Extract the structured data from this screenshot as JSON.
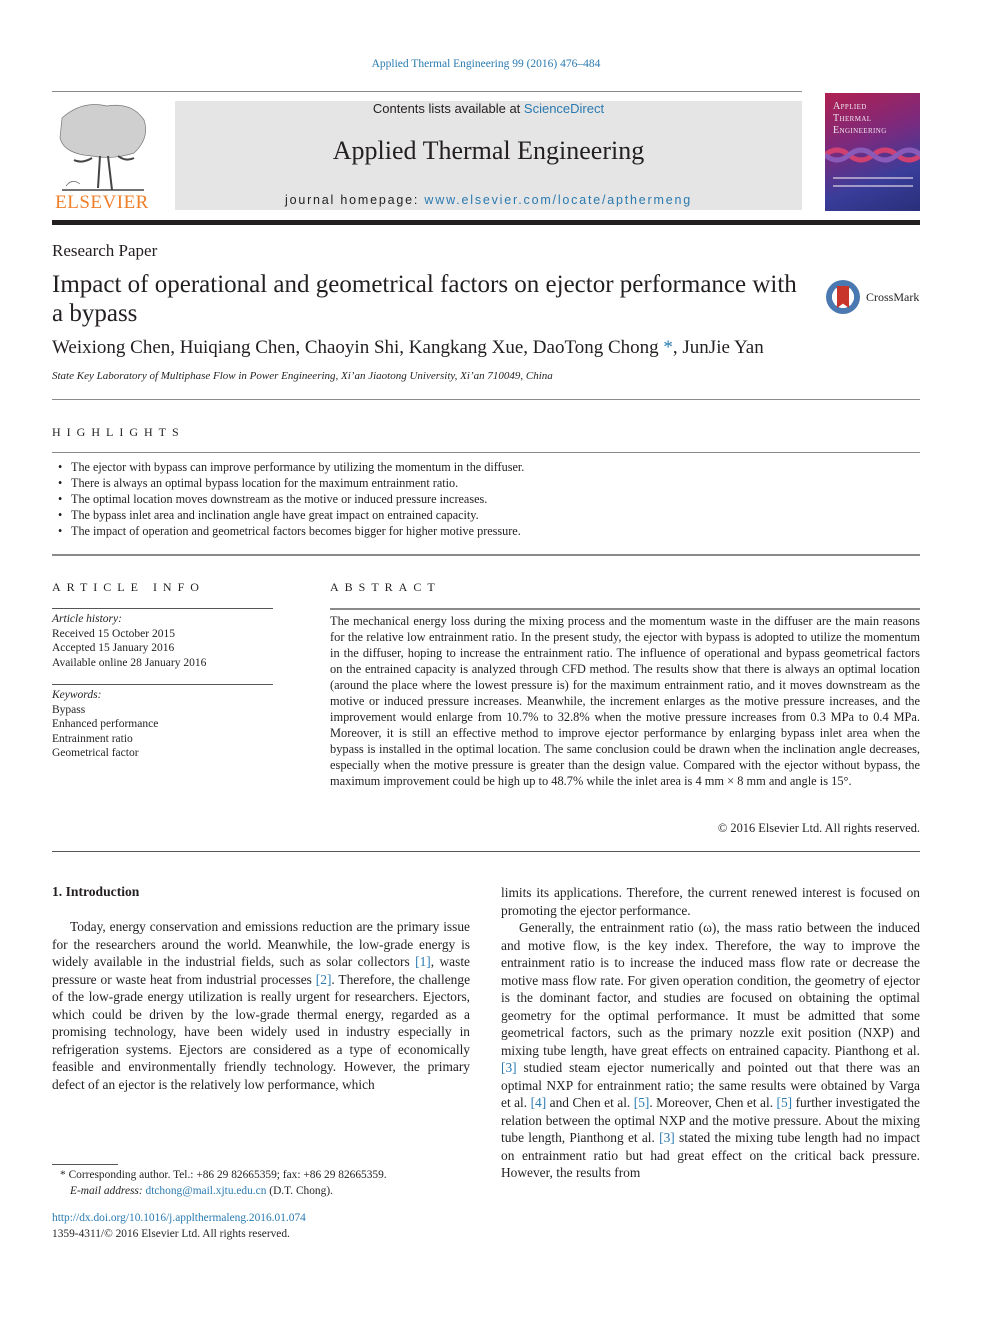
{
  "header": {
    "journal_ref": "Applied Thermal Engineering 99 (2016) 476–484",
    "contents_prefix": "Contents lists available at ",
    "contents_link": "ScienceDirect",
    "journal_title": "Applied Thermal Engineering",
    "homepage_prefix": "journal homepage: ",
    "homepage_link": "www.elsevier.com/locate/apthermeng",
    "publisher_logo_text": "ELSEVIER",
    "cover_title_lines": [
      "Applied",
      "Thermal",
      "Engineering"
    ],
    "publisher_color": "#f07f2a",
    "link_color": "#2a7ab0"
  },
  "article": {
    "type": "Research Paper",
    "title": "Impact of operational and geometrical factors on ejector performance with a bypass",
    "crossmark_label": "CrossMark",
    "authors_before_star": "Weixiong Chen, Huiqiang Chen, Chaoyin Shi, Kangkang Xue, DaoTong Chong ",
    "author_star": "*",
    "authors_after_star": ", JunJie Yan",
    "affiliation": "State Key Laboratory of Multiphase Flow in Power Engineering, Xi’an Jiaotong University, Xi’an 710049, China"
  },
  "highlights": {
    "label": "HIGHLIGHTS",
    "bullet": "•",
    "items": [
      "The ejector with bypass can improve performance by utilizing the momentum in the diffuser.",
      "There is always an optimal bypass location for the maximum entrainment ratio.",
      "The optimal location moves downstream as the motive or induced pressure increases.",
      "The bypass inlet area and inclination angle have great impact on entrained capacity.",
      "The impact of operation and geometrical factors becomes bigger for higher motive pressure."
    ]
  },
  "article_info": {
    "label": "ARTICLE INFO",
    "history_heading": "Article history:",
    "history": [
      "Received 15 October 2015",
      "Accepted 15 January 2016",
      "Available online 28 January 2016"
    ],
    "keywords_heading": "Keywords:",
    "keywords": [
      "Bypass",
      "Enhanced performance",
      "Entrainment ratio",
      "Geometrical factor"
    ]
  },
  "abstract": {
    "label": "ABSTRACT",
    "text": "The mechanical energy loss during the mixing process and the momentum waste in the diffuser are the main reasons for the relative low entrainment ratio. In the present study, the ejector with bypass is adopted to utilize the momentum in the diffuser, hoping to increase the entrainment ratio. The influence of operational and bypass geometrical factors on the entrained capacity is analyzed through CFD method. The results show that there is always an optimal location (around the place where the lowest pressure is) for the maximum entrainment ratio, and it moves downstream as the motive or induced pressure increases. Meanwhile, the increment enlarges as the motive pressure increases, and the improvement would enlarge from 10.7% to 32.8% when the motive pressure increases from 0.3 MPa to 0.4 MPa. Moreover, it is still an effective method to improve ejector performance by enlarging bypass inlet area when the bypass is installed in the optimal location. The same conclusion could be drawn when the inclination angle decreases, especially when the motive pressure is greater than the design value. Compared with the ejector without bypass, the maximum improvement could be high up to 48.7% while the inlet area is 4 mm × 8 mm and angle is 15°.",
    "copyright": "© 2016 Elsevier Ltd. All rights reserved."
  },
  "body": {
    "intro_heading": "1.  Introduction",
    "left_p1": [
      {
        "t": "Today, energy conservation and emissions reduction are the primary issue for the researchers around the world. Meanwhile, the low-grade energy is widely available in the industrial fields, such as solar collectors "
      },
      {
        "ref": "[1]"
      },
      {
        "t": ", waste pressure or waste heat from industrial processes "
      },
      {
        "ref": "[2]"
      },
      {
        "t": ". Therefore, the challenge of the low-grade energy utilization is really urgent for researchers. Ejectors, which could be driven by the low-grade thermal energy, regarded as a promising technology, have been widely used in industry especially in refrigeration systems. Ejectors are considered as a type of economically feasible and environmentally friendly technology. However, the primary defect of an ejector is the relatively low performance, which"
      }
    ],
    "right_p1": "limits its applications. Therefore, the current renewed interest is focused on promoting the ejector performance.",
    "right_p2": [
      {
        "t": "Generally, the entrainment ratio (ω), the mass ratio between the induced and motive flow, is the key index. Therefore, the way to improve the entrainment ratio is to increase the induced mass flow rate or decrease the motive mass flow rate. For given operation condition, the geometry of ejector is the dominant factor, and studies are focused on obtaining the optimal geometry for the optimal performance. It must be admitted that some geometrical factors, such as the primary nozzle exit position (NXP) and mixing tube length, have great effects on entrained capacity. Pianthong et al. "
      },
      {
        "ref": "[3]"
      },
      {
        "t": " studied steam ejector numerically and pointed out that there was an optimal NXP for entrainment ratio; the same results were obtained by Varga et al. "
      },
      {
        "ref": "[4]"
      },
      {
        "t": " and Chen et al. "
      },
      {
        "ref": "[5]"
      },
      {
        "t": ". Moreover, Chen et al. "
      },
      {
        "ref": "[5]"
      },
      {
        "t": " further investigated the relation between the optimal NXP and the motive pressure. About the mixing tube length, Pianthong et al. "
      },
      {
        "ref": "[3]"
      },
      {
        "t": " stated the mixing tube length had no impact on entrainment ratio but had great effect on the critical back pressure. However, the results from"
      }
    ]
  },
  "footnote": {
    "star": "*",
    "corresponding": "Corresponding author. Tel.: +86 29 82665359; fax: +86 29 82665359.",
    "email_label": "E-mail address: ",
    "email": "dtchong@mail.xjtu.edu.cn",
    "email_suffix": " (D.T. Chong).",
    "doi": "http://dx.doi.org/10.1016/j.applthermaleng.2016.01.074",
    "issn_line": "1359-4311/© 2016 Elsevier Ltd. All rights reserved."
  }
}
